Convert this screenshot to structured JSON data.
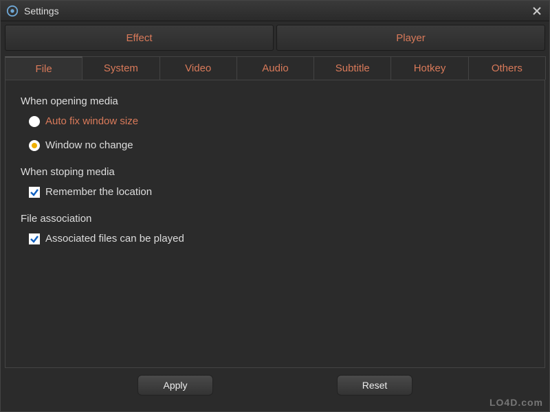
{
  "window": {
    "title": "Settings"
  },
  "mainTabs": {
    "effect": "Effect",
    "player": "Player"
  },
  "subTabs": {
    "file": "File",
    "system": "System",
    "video": "Video",
    "audio": "Audio",
    "subtitle": "Subtitle",
    "hotkey": "Hotkey",
    "others": "Others"
  },
  "sections": {
    "opening": {
      "title": "When opening media",
      "option1": "Auto fix window size",
      "option2": "Window no change"
    },
    "stopping": {
      "title": "When stoping media",
      "remember": "Remember the location"
    },
    "association": {
      "title": "File association",
      "associated": "Associated files can be played"
    }
  },
  "buttons": {
    "apply": "Apply",
    "reset": "Reset"
  },
  "watermark": "LO4D.com"
}
